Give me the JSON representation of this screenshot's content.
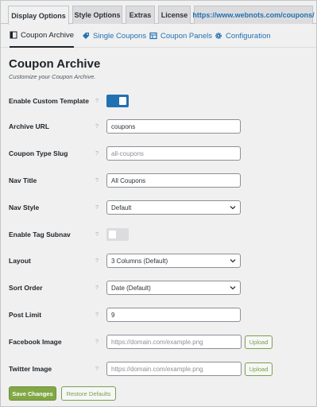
{
  "top_tabs": [
    {
      "label": "Display Options",
      "active": true
    },
    {
      "label": "Style Options",
      "active": false
    },
    {
      "label": "Extras",
      "active": false
    },
    {
      "label": "License",
      "active": false
    },
    {
      "label": "https://www.webnots.com/coupons/",
      "active": false
    }
  ],
  "sub_tabs": [
    {
      "label": "Coupon Archive",
      "icon": "coupon-archive-icon",
      "active": true
    },
    {
      "label": "Single Coupons",
      "icon": "tag-icon",
      "active": false
    },
    {
      "label": "Coupon Panels",
      "icon": "panels-icon",
      "active": false
    },
    {
      "label": "Configuration",
      "icon": "gear-icon",
      "active": false
    }
  ],
  "page": {
    "title": "Coupon Archive",
    "subtitle": "Customize your Coupon Archive."
  },
  "help_glyph": "?",
  "fields": {
    "custom_template": {
      "label": "Enable Custom Template",
      "on": true
    },
    "archive_url": {
      "label": "Archive URL",
      "value": "coupons"
    },
    "type_slug": {
      "label": "Coupon Type Slug",
      "placeholder": "all-coupons"
    },
    "nav_title": {
      "label": "Nav Title",
      "value": "All Coupons"
    },
    "nav_style": {
      "label": "Nav Style",
      "value": "Default"
    },
    "tag_subnav": {
      "label": "Enable Tag Subnav",
      "on": false
    },
    "layout": {
      "label": "Layout",
      "value": "3 Columns (Default)"
    },
    "sort_order": {
      "label": "Sort Order",
      "value": "Date (Default)"
    },
    "post_limit": {
      "label": "Post Limit",
      "value": "9"
    },
    "facebook_image": {
      "label": "Facebook Image",
      "placeholder": "https://domain.com/example.png",
      "button": "Upload"
    },
    "twitter_image": {
      "label": "Twitter Image",
      "placeholder": "https://domain.com/example.png",
      "button": "Upload"
    }
  },
  "buttons": {
    "save": "Save Changes",
    "restore": "Restore Defaults"
  },
  "colors": {
    "accent": "#2271b1",
    "save_green": "#81a845",
    "background": "#f0f0f1"
  }
}
